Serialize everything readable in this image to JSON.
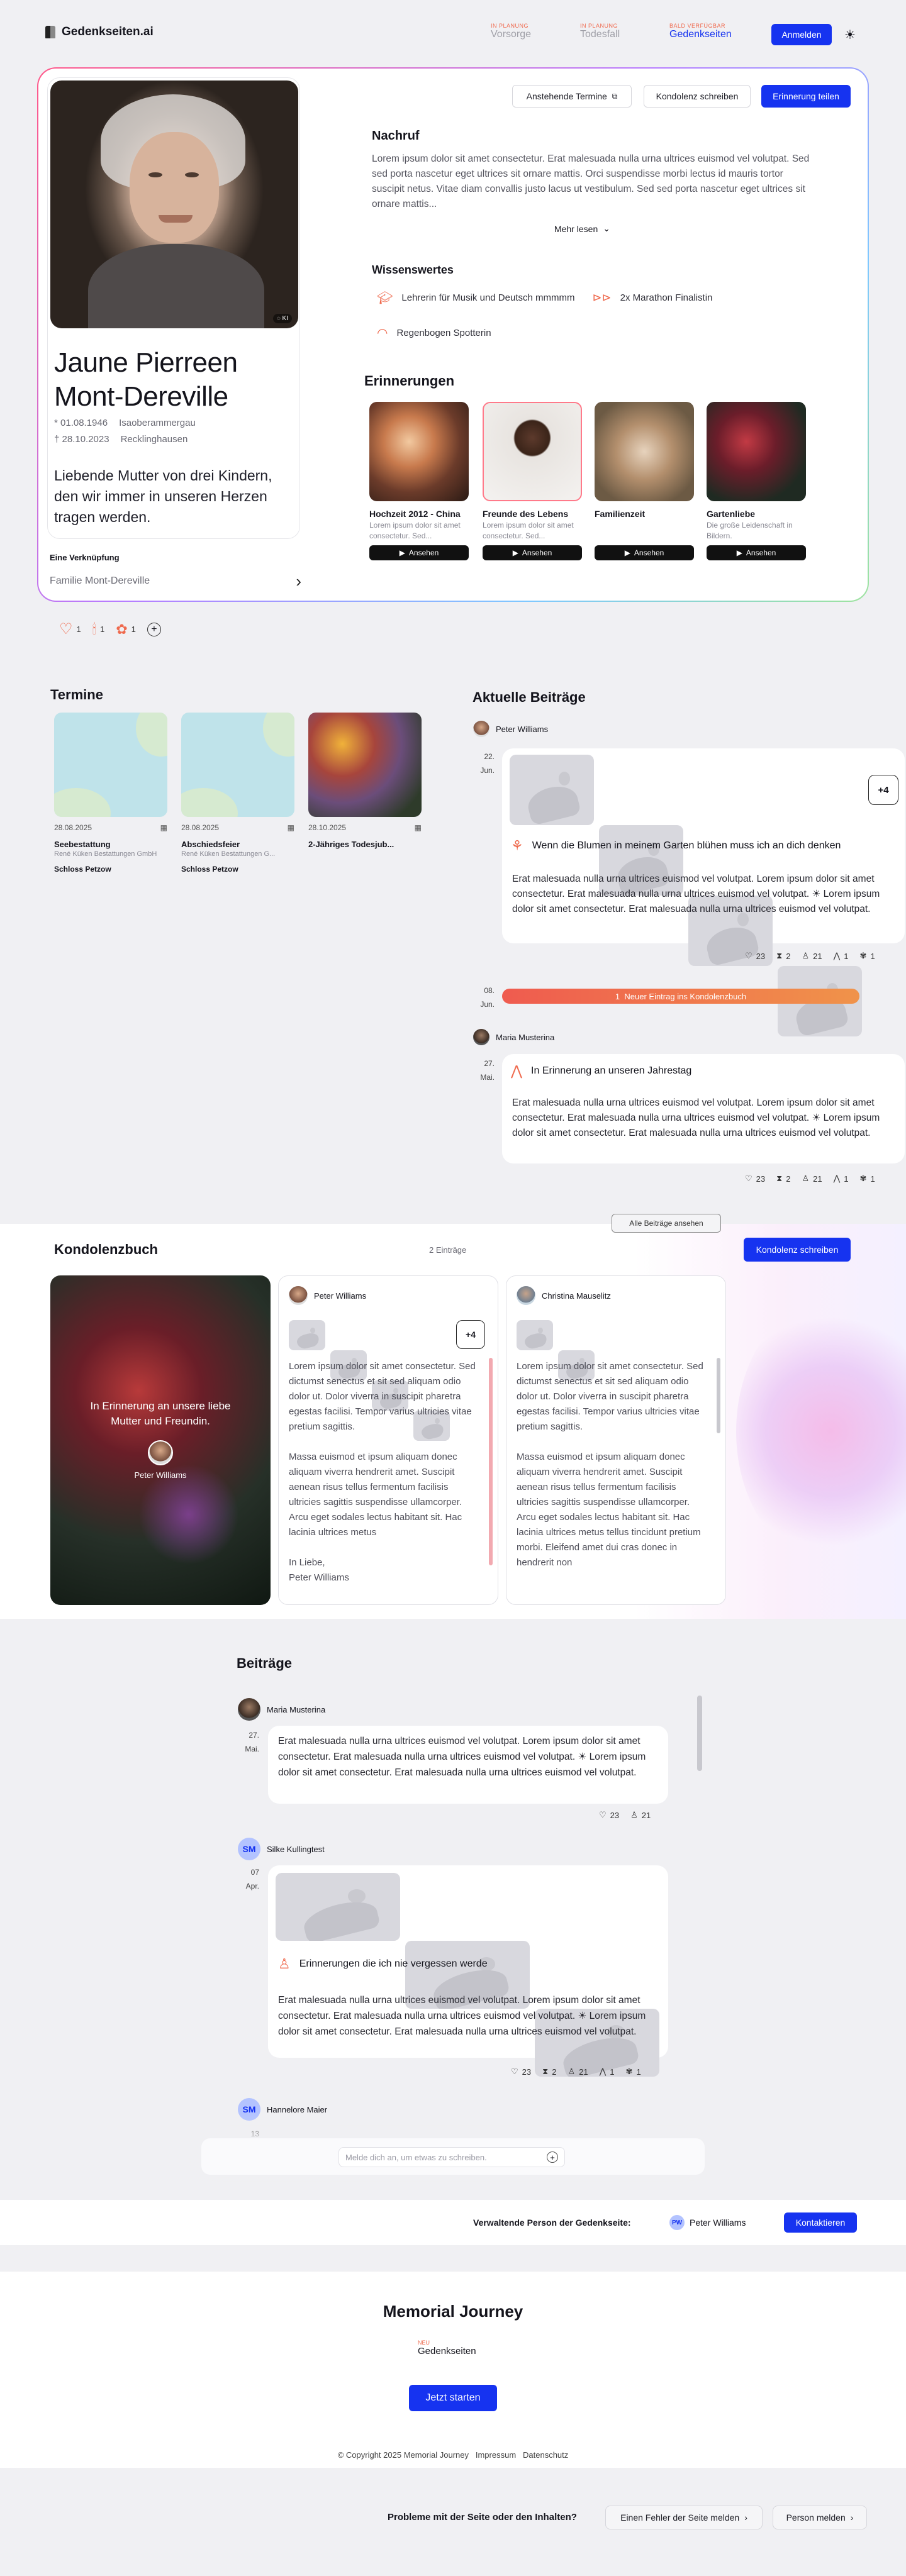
{
  "header": {
    "logo": "Gedenkseiten.ai",
    "nav": [
      {
        "tag": "IN PLANUNG",
        "label": "Vorsorge"
      },
      {
        "tag": "IN PLANUNG",
        "label": "Todesfall"
      },
      {
        "tag": "BALD VERFÜGBAR",
        "label": "Gedenkseiten"
      }
    ],
    "login": "Anmelden"
  },
  "hero": {
    "toolbar": {
      "events": "Anstehende Termine",
      "condolence": "Kondolenz schreiben",
      "share": "Erinnerung teilen"
    },
    "photo_badge": "KI",
    "name_line1": "Jaune Pierreen",
    "name_line2": "Mont-Dereville",
    "birth_date": "* 01.08.1946",
    "birth_place": "Isaoberammergau",
    "death_date": "† 28.10.2023",
    "death_place": "Recklinghausen",
    "quote": "Liebende Mutter von drei Kindern, den wir immer in unseren Herzen tragen werden.",
    "link_label": "Eine Verknüpfung",
    "link_value": "Familie Mont-Dereville",
    "obituary_title": "Nachruf",
    "obituary_text": "Lorem ipsum dolor sit amet consectetur. Erat malesuada nulla urna ultrices euismod vel volutpat. Sed sed porta nascetur eget ultrices sit ornare mattis. Orci suspendisse morbi lectus id mauris tortor suscipit netus. Vitae diam convallis justo lacus ut vestibulum. Sed sed porta nascetur eget ultrices sit ornare mattis...",
    "read_more": "Mehr lesen",
    "facts_title": "Wissenswertes",
    "facts": [
      "Lehrerin für Musik und Deutsch mmmmm",
      "2x Marathon Finalistin",
      "Regenbogen Spotterin"
    ],
    "memories_title": "Erinnerungen",
    "memories": [
      {
        "title": "Hochzeit 2012 - China",
        "desc": "Lorem ipsum dolor sit amet consectetur. Sed...",
        "button": "Ansehen"
      },
      {
        "title": "Freunde des Lebens",
        "desc": "Lorem ipsum dolor sit amet consectetur. Sed...",
        "button": "Ansehen"
      },
      {
        "title": "Familienzeit",
        "desc": "",
        "button": "Ansehen"
      },
      {
        "title": "Gartenliebe",
        "desc": "Die große Leidenschaft in Bildern.",
        "button": "Ansehen"
      }
    ],
    "reactions": [
      "1",
      "1",
      "1"
    ]
  },
  "events": {
    "title": "Termine",
    "items": [
      {
        "date": "28.08.2025",
        "title": "Seebestattung",
        "org": "René Küken Bestattungen GmbH",
        "place": "Schloss Petzow"
      },
      {
        "date": "28.08.2025",
        "title": "Abschiedsfeier",
        "org": "René Küken Bestattungen G...",
        "place": "Schloss Petzow"
      },
      {
        "date": "28.10.2025",
        "title": "2-Jähriges Todesjub...",
        "org": "",
        "place": ""
      }
    ]
  },
  "feed": {
    "title": "Aktuelle Beiträge",
    "post1": {
      "author": "Peter Williams",
      "day": "22.",
      "month": "Jun.",
      "more": "+4",
      "headline": "Wenn die Blumen in meinem Garten blühen muss ich an dich denken",
      "text": "Erat malesuada nulla urna ultrices euismod vel volutpat. Lorem ipsum dolor sit amet consectetur. Erat malesuada nulla urna ultrices euismod vel volutpat. ☀ Lorem ipsum dolor sit amet consectetur. Erat malesuada nulla urna ultrices euismod vel volutpat.",
      "stats": [
        "23",
        "2",
        "21",
        "1",
        "1"
      ]
    },
    "notice": {
      "day": "08.",
      "month": "Jun.",
      "text": "1  Neuer Eintrag ins Kondolenzbuch"
    },
    "post2": {
      "author": "Maria Musterina",
      "day": "27.",
      "month": "Mai.",
      "headline": "In Erinnerung an unseren Jahrestag",
      "text": "Erat malesuada nulla urna ultrices euismod vel volutpat. Lorem ipsum dolor sit amet consectetur. Erat malesuada nulla urna ultrices euismod vel volutpat. ☀ Lorem ipsum dolor sit amet consectetur. Erat malesuada nulla urna ultrices euismod vel volutpat.",
      "stats": [
        "23",
        "2",
        "21",
        "1",
        "1"
      ]
    },
    "all_posts": "Alle Beiträge ansehen"
  },
  "condolence": {
    "title": "Kondolenzbuch",
    "count": "2 Einträge",
    "write": "Kondolenz schreiben",
    "cover_text": "In Erinnerung an unsere liebe Mutter und Freundin.",
    "cover_author": "Peter Williams",
    "entries": [
      {
        "author": "Peter Williams",
        "more": "+4",
        "text": "Lorem ipsum dolor sit amet consectetur. Sed dictumst senectus et sit sed aliquam odio dolor ut. Dolor viverra in suscipit pharetra egestas facilisi. Tempor varius ultricies vitae pretium sagittis.",
        "text2": "Massa euismod et ipsum aliquam donec aliquam viverra hendrerit amet. Suscipit aenean risus tellus fermentum facilisis ultricies sagittis suspendisse ullamcorper. Arcu eget sodales lectus habitant sit. Hac lacinia ultrices metus",
        "closing": "In Liebe,",
        "signature": "Peter Williams"
      },
      {
        "author": "Christina Mauselitz",
        "text": "Lorem ipsum dolor sit amet consectetur. Sed dictumst senectus et sit sed aliquam odio dolor ut. Dolor viverra in suscipit pharetra egestas facilisi. Tempor varius ultricies vitae pretium sagittis.",
        "text2": "Massa euismod et ipsum aliquam donec aliquam viverra hendrerit amet. Suscipit aenean risus tellus fermentum facilisis ultricies sagittis suspendisse ullamcorper. Arcu eget sodales lectus habitant sit. Hac lacinia ultrices metus tellus tincidunt pretium morbi. Eleifend amet dui cras donec in hendrerit non"
      }
    ]
  },
  "posts": {
    "title": "Beiträge",
    "p1": {
      "author": "Maria Musterina",
      "day": "27.",
      "month": "Mai.",
      "text": "Erat malesuada nulla urna ultrices euismod vel volutpat. Lorem ipsum dolor sit amet consectetur. Erat malesuada nulla urna ultrices euismod vel volutpat. ☀ Lorem ipsum dolor sit amet consectetur. Erat malesuada nulla urna ultrices euismod vel volutpat.",
      "stats": [
        "23",
        "21"
      ]
    },
    "p2": {
      "author": "Silke Kullingtest",
      "initials": "SM",
      "day": "07",
      "month": "Apr.",
      "headline": "Erinnerungen die ich nie vergessen werde",
      "text": "Erat malesuada nulla urna ultrices euismod vel volutpat. Lorem ipsum dolor sit amet consectetur. Erat malesuada nulla urna ultrices euismod vel volutpat. ☀ Lorem ipsum dolor sit amet consectetur. Erat malesuada nulla urna ultrices euismod vel volutpat.",
      "stats": [
        "23",
        "2",
        "21",
        "1",
        "1"
      ]
    },
    "p3": {
      "author": "Hannelore Maier",
      "initials": "SM",
      "day": "13"
    },
    "input_placeholder": "Melde dich an, um etwas zu schreiben."
  },
  "admin": {
    "label": "Verwaltende Person der Gedenkseite:",
    "initials": "PW",
    "name": "Peter Williams",
    "contact": "Kontaktieren"
  },
  "footer": {
    "brand": "Memorial Journey",
    "sublogo_tag": "NEU",
    "sublogo": "Gedenkseiten",
    "start": "Jetzt starten",
    "copyright": "© Copyright 2025 Memorial Journey",
    "imprint": "Impressum",
    "privacy": "Datenschutz"
  },
  "report": {
    "question": "Probleme mit der Seite oder den Inhalten?",
    "error": "Einen Fehler der Seite melden",
    "person": "Person melden"
  },
  "colors": {
    "accent": "#1633f0",
    "coral": "#ef6a4e",
    "orange": "#f08b4a"
  }
}
